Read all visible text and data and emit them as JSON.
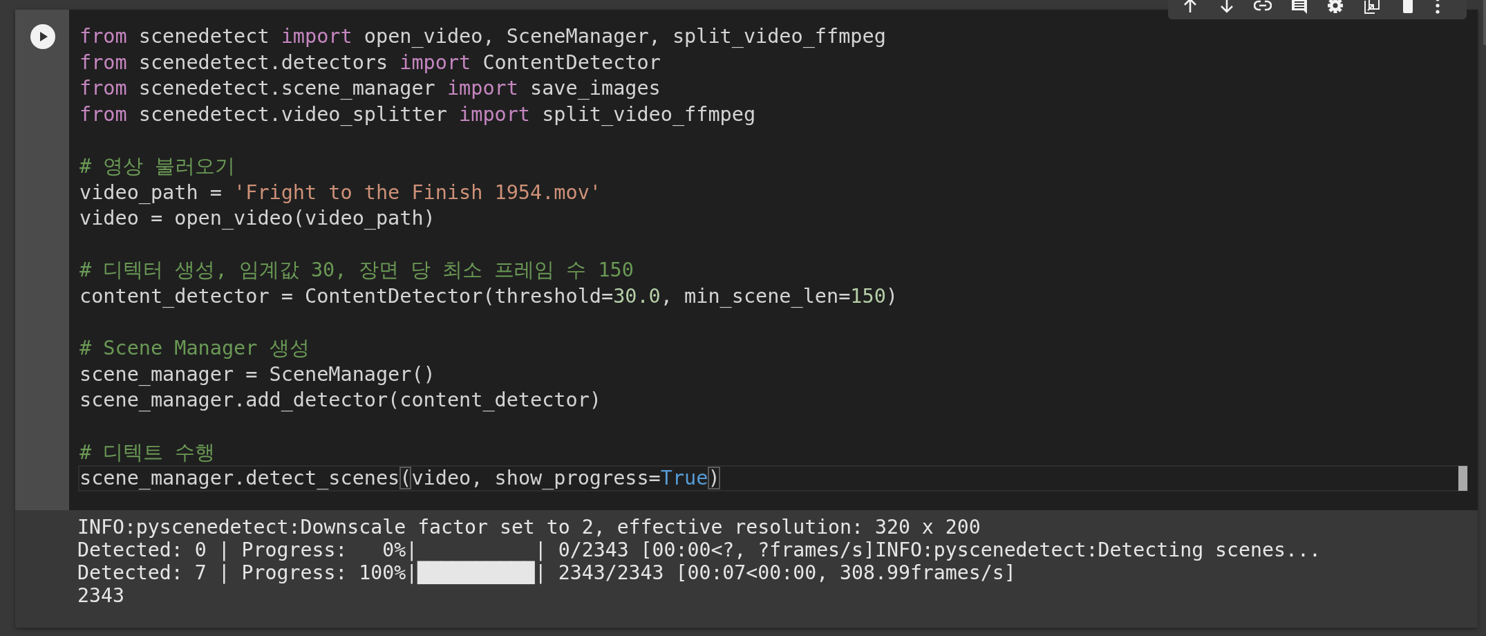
{
  "toolbar": {
    "buttons": [
      {
        "kind": "up"
      },
      {
        "kind": "down"
      },
      {
        "kind": "link"
      },
      {
        "kind": "comment"
      },
      {
        "kind": "settings"
      },
      {
        "kind": "mirror"
      },
      {
        "kind": "delete"
      },
      {
        "kind": "more"
      }
    ]
  },
  "code_cell": {
    "lines": [
      {
        "kind": "code",
        "current": false,
        "tokens": [
          {
            "kind": "keyword",
            "text": "from"
          },
          {
            "kind": "plain",
            "text": " scenedetect "
          },
          {
            "kind": "keyword",
            "text": "import"
          },
          {
            "kind": "plain",
            "text": " open_video, SceneManager, split_video_ffmpeg"
          }
        ]
      },
      {
        "kind": "code",
        "current": false,
        "tokens": [
          {
            "kind": "keyword",
            "text": "from"
          },
          {
            "kind": "plain",
            "text": " scenedetect.detectors "
          },
          {
            "kind": "keyword",
            "text": "import"
          },
          {
            "kind": "plain",
            "text": " ContentDetector"
          }
        ]
      },
      {
        "kind": "code",
        "current": false,
        "tokens": [
          {
            "kind": "keyword",
            "text": "from"
          },
          {
            "kind": "plain",
            "text": " scenedetect.scene_manager "
          },
          {
            "kind": "keyword",
            "text": "import"
          },
          {
            "kind": "plain",
            "text": " save_images"
          }
        ]
      },
      {
        "kind": "code",
        "current": false,
        "tokens": [
          {
            "kind": "keyword",
            "text": "from"
          },
          {
            "kind": "plain",
            "text": " scenedetect.video_splitter "
          },
          {
            "kind": "keyword",
            "text": "import"
          },
          {
            "kind": "plain",
            "text": " split_video_ffmpeg"
          }
        ]
      },
      {
        "kind": "blank"
      },
      {
        "kind": "code",
        "current": false,
        "tokens": [
          {
            "kind": "comment",
            "text": "# 영상 불러오기"
          }
        ]
      },
      {
        "kind": "code",
        "current": false,
        "tokens": [
          {
            "kind": "plain",
            "text": "video_path = "
          },
          {
            "kind": "string",
            "text": "'Fright to the Finish 1954.mov'"
          }
        ]
      },
      {
        "kind": "code",
        "current": false,
        "tokens": [
          {
            "kind": "plain",
            "text": "video = open_video(video_path)"
          }
        ]
      },
      {
        "kind": "blank"
      },
      {
        "kind": "code",
        "current": false,
        "tokens": [
          {
            "kind": "comment",
            "text": "# 디텍터 생성, 임계값 30, 장면 당 최소 프레임 수 150"
          }
        ]
      },
      {
        "kind": "code",
        "current": false,
        "tokens": [
          {
            "kind": "plain",
            "text": "content_detector = ContentDetector(threshold="
          },
          {
            "kind": "number",
            "text": "30.0"
          },
          {
            "kind": "plain",
            "text": ", min_scene_len="
          },
          {
            "kind": "number",
            "text": "150"
          },
          {
            "kind": "plain",
            "text": ")"
          }
        ]
      },
      {
        "kind": "blank"
      },
      {
        "kind": "code",
        "current": false,
        "tokens": [
          {
            "kind": "comment",
            "text": "# Scene Manager 생성"
          }
        ]
      },
      {
        "kind": "code",
        "current": false,
        "tokens": [
          {
            "kind": "plain",
            "text": "scene_manager = SceneManager()"
          }
        ]
      },
      {
        "kind": "code",
        "current": false,
        "tokens": [
          {
            "kind": "plain",
            "text": "scene_manager.add_detector(content_detector)"
          }
        ]
      },
      {
        "kind": "blank"
      },
      {
        "kind": "code",
        "current": false,
        "tokens": [
          {
            "kind": "comment",
            "text": "# 디텍트 수행"
          }
        ]
      },
      {
        "kind": "code",
        "current": true,
        "tokens": [
          {
            "kind": "plain",
            "text": "scene_manager.detect_scenes"
          },
          {
            "kind": "bracket",
            "text": "("
          },
          {
            "kind": "plain",
            "text": "video, show_progress="
          },
          {
            "kind": "boolean",
            "text": "True"
          },
          {
            "kind": "bracket",
            "text": ")"
          }
        ]
      }
    ]
  },
  "output": {
    "lines": [
      "INFO:pyscenedetect:Downscale factor set to 2, effective resolution: 320 x 200",
      "Detected: 0 | Progress:   0%|          | 0/2343 [00:00<?, ?frames/s]INFO:pyscenedetect:Detecting scenes...",
      "Detected: 7 | Progress: 100%|██████████| 2343/2343 [00:07<00:00, 308.99frames/s]",
      "2343"
    ]
  }
}
